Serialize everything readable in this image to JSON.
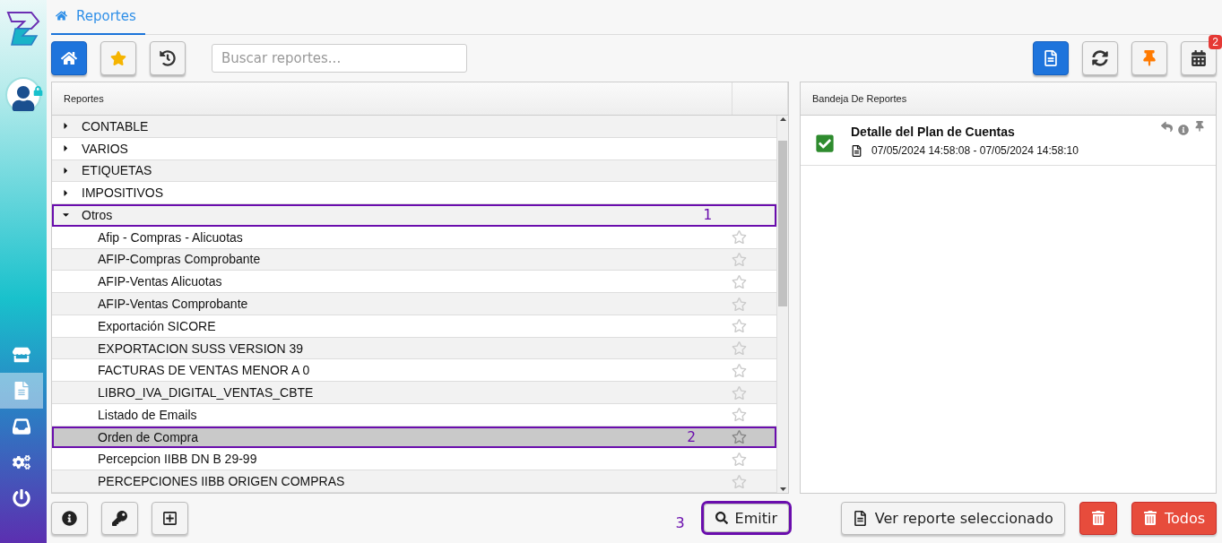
{
  "header_tab": {
    "label": "Reportes",
    "selected": true
  },
  "sidebar": [
    {
      "kind": "store",
      "selected": false
    },
    {
      "kind": "reports",
      "selected": true
    },
    {
      "kind": "inbox",
      "selected": false
    },
    {
      "kind": "settings",
      "selected": false
    },
    {
      "kind": "power",
      "selected": false
    }
  ],
  "toolbar_left": [
    {
      "kind": "home",
      "selected": true
    },
    {
      "kind": "favorites",
      "selected": false
    },
    {
      "kind": "history",
      "selected": false
    }
  ],
  "search": {
    "placeholder": "Buscar reportes..."
  },
  "toolbar_right": [
    {
      "kind": "document",
      "selected": true
    },
    {
      "kind": "refresh",
      "selected": false
    },
    {
      "kind": "pin",
      "selected": false
    },
    {
      "kind": "calendar",
      "selected": false,
      "badge": "2"
    }
  ],
  "left_panel": {
    "title": "Reportes",
    "categories": [
      {
        "label": "CONTABLE",
        "expanded": false
      },
      {
        "label": "VARIOS",
        "expanded": false
      },
      {
        "label": "ETIQUETAS",
        "expanded": false
      },
      {
        "label": "IMPOSITIVOS",
        "expanded": false
      },
      {
        "label": "Otros",
        "expanded": true,
        "callout": "1",
        "children": [
          {
            "label": "Afip - Compras - Alicuotas",
            "selected": false,
            "favorite": false
          },
          {
            "label": "AFIP-Compras Comprobante",
            "selected": false,
            "favorite": false
          },
          {
            "label": "AFIP-Ventas Alicuotas",
            "selected": false,
            "favorite": false
          },
          {
            "label": "AFIP-Ventas Comprobante",
            "selected": false,
            "favorite": false
          },
          {
            "label": "Exportación SICORE",
            "selected": false,
            "favorite": false
          },
          {
            "label": "EXPORTACION SUSS VERSION 39",
            "selected": false,
            "favorite": false
          },
          {
            "label": "FACTURAS DE VENTAS MENOR A 0",
            "selected": false,
            "favorite": false
          },
          {
            "label": "LIBRO_IVA_DIGITAL_VENTAS_CBTE",
            "selected": false,
            "favorite": false
          },
          {
            "label": "Listado de Emails",
            "selected": false,
            "favorite": false
          },
          {
            "label": "Orden de Compra",
            "selected": true,
            "favorite": false,
            "callout": "2"
          },
          {
            "label": "Percepcion IIBB DN B 29-99",
            "selected": false,
            "favorite": false
          },
          {
            "label": "PERCEPCIONES IIBB ORIGEN COMPRAS",
            "selected": false,
            "favorite": false
          }
        ]
      }
    ]
  },
  "left_buttons": [
    {
      "kind": "info"
    },
    {
      "kind": "key"
    },
    {
      "kind": "add"
    }
  ],
  "emit_button": {
    "label": "Emitir",
    "callout": "3"
  },
  "right_panel": {
    "title": "Bandeja De Reportes",
    "items": [
      {
        "title": "Detalle del Plan de Cuentas",
        "done": true,
        "time": "07/05/2024 14:58:08 - 07/05/2024 14:58:10"
      }
    ]
  },
  "view_button": {
    "label": "Ver reporte seleccionado"
  },
  "delete_all_button": {
    "label": "Todos"
  }
}
